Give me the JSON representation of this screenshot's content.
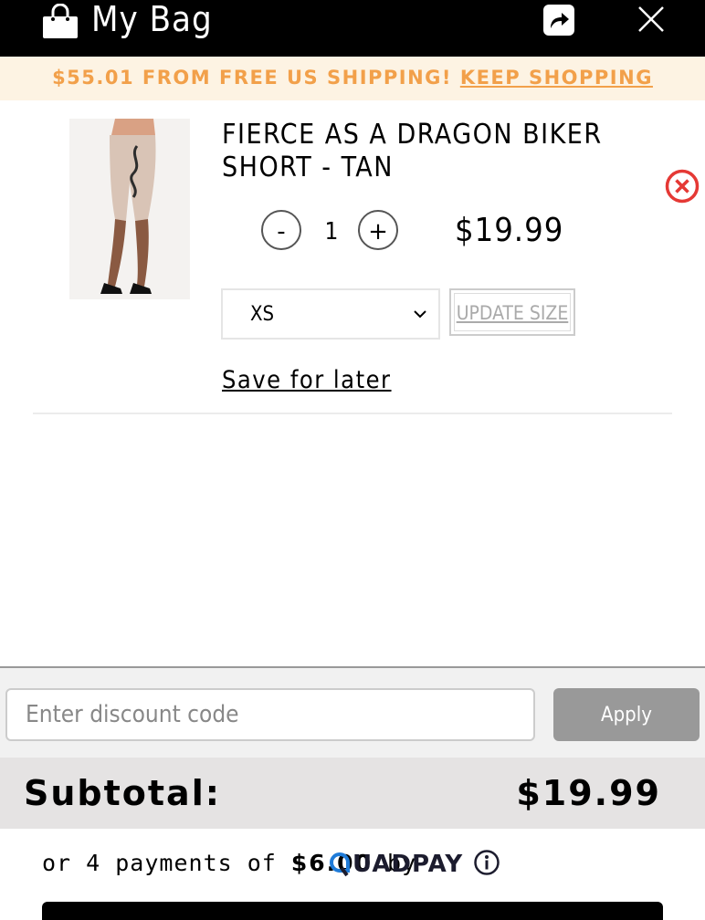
{
  "header": {
    "title": "My Bag",
    "share_icon": "share-arrow-icon",
    "close_icon": "close-icon",
    "bag_icon": "shopping-bag-icon"
  },
  "banner": {
    "message": "$55.01 FROM FREE US SHIPPING!",
    "link": "KEEP SHOPPING",
    "color": "#f2a04a",
    "background": "#fdf3e3"
  },
  "cart_item": {
    "title": "FIERCE AS A DRAGON BIKER SHORT - TAN",
    "quantity": "1",
    "minus_label": "-",
    "plus_label": "+",
    "price": "$19.99",
    "size": "XS",
    "update_size_label": "UPDATE SIZE",
    "save_for_later_label": "Save for later",
    "remove_icon": "remove-circle-icon",
    "remove_color": "#e53935"
  },
  "discount": {
    "placeholder": "Enter discount code",
    "apply_label": "Apply"
  },
  "subtotal": {
    "label": "Subtotal:",
    "value": "$19.99"
  },
  "installments": {
    "prefix": "or 4 payments of",
    "amount": "$6.00",
    "by": "by",
    "provider": "UADPAY",
    "provider_color": "#1c1c2e",
    "provider_accent": "#1f7bd8"
  }
}
